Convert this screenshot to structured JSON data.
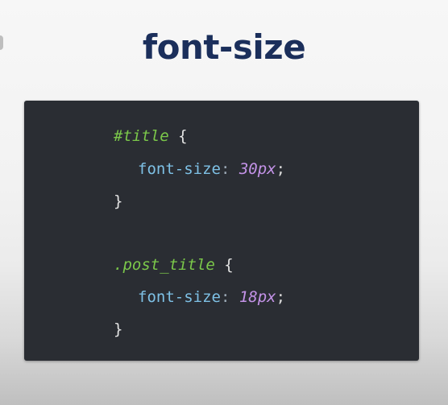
{
  "slide": {
    "title": "font-size"
  },
  "code": {
    "rule1": {
      "selector": "#title",
      "open_brace": " {",
      "property": "font-size",
      "colon": ": ",
      "value": "30px",
      "semicolon": ";",
      "close_brace": "}"
    },
    "rule2": {
      "selector": ".post_title",
      "open_brace": " {",
      "property": "font-size",
      "colon": ": ",
      "value": "18px",
      "semicolon": ";",
      "close_brace": "}"
    }
  },
  "colors": {
    "title": "#1b2f5b",
    "panel_background": "#2a2d33",
    "selector": "#7bc84a",
    "property": "#7ec1e6",
    "value": "#c493e8"
  }
}
